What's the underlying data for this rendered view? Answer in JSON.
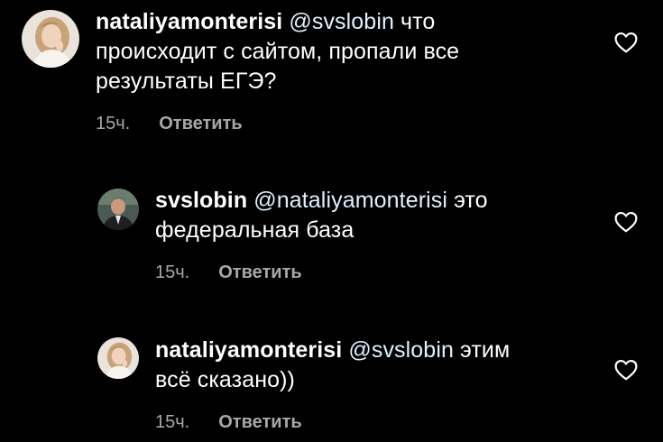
{
  "comments": [
    {
      "username": "nataliyamonterisi",
      "mention": "@svslobin",
      "text_line1_rest": "что",
      "text_line2": "происходит с сайтом, пропали все",
      "text_line3": "результаты ЕГЭ?",
      "time": "15ч.",
      "reply_label": "Ответить",
      "avatar_icon": "woman-avatar"
    },
    {
      "username": "svslobin",
      "mention": "@nataliyamonterisi",
      "text_line1_rest": "это",
      "text_line2": "федеральная база",
      "time": "15ч.",
      "reply_label": "Ответить",
      "avatar_icon": "man-avatar"
    },
    {
      "username": "nataliyamonterisi",
      "mention": "@svslobin",
      "text_line1_rest": "этим",
      "text_line2": "всё сказано))",
      "time": "15ч.",
      "reply_label": "Ответить",
      "avatar_icon": "woman-avatar"
    }
  ],
  "colors": {
    "background": "#000000",
    "text": "#ffffff",
    "mention": "#e0f1ff",
    "meta": "#a8a8a8",
    "heart": "#ffffff"
  },
  "icons": {
    "like": "heart-outline-icon"
  }
}
